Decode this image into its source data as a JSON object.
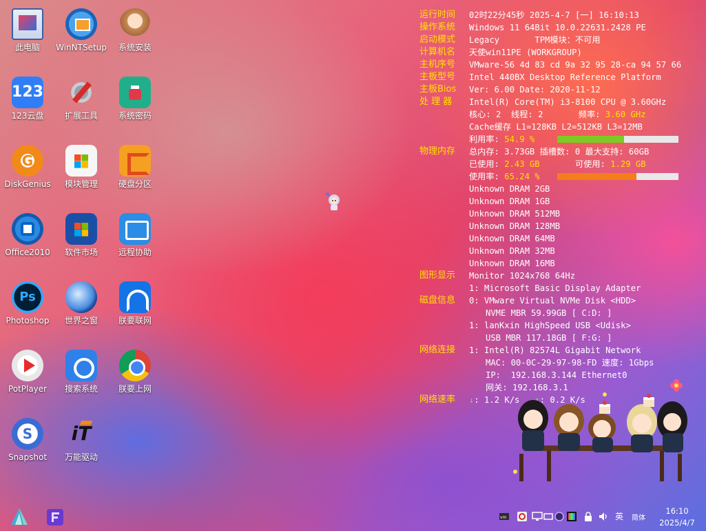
{
  "desktop": {
    "icons": [
      {
        "label": "此电脑",
        "icon": "computer-icon"
      },
      {
        "label": "WinNTSetup",
        "icon": "winntsetup-icon"
      },
      {
        "label": "系统安装",
        "icon": "system-install-icon"
      },
      {
        "label": "123云盘",
        "icon": "123-cloud-icon"
      },
      {
        "label": "扩展工具",
        "icon": "tools-icon"
      },
      {
        "label": "系统密码",
        "icon": "password-icon"
      },
      {
        "label": "DiskGenius",
        "icon": "diskgenius-icon"
      },
      {
        "label": "模块管理",
        "icon": "module-manager-icon"
      },
      {
        "label": "硬盘分区",
        "icon": "disk-partition-icon"
      },
      {
        "label": "Office2010",
        "icon": "office-icon"
      },
      {
        "label": "软件市场",
        "icon": "software-market-icon"
      },
      {
        "label": "远程协助",
        "icon": "remote-assist-icon"
      },
      {
        "label": "Photoshop",
        "icon": "photoshop-icon"
      },
      {
        "label": "世界之窗",
        "icon": "browser-globe-icon"
      },
      {
        "label": "朕要联网",
        "icon": "wifi-icon"
      },
      {
        "label": "PotPlayer",
        "icon": "potplayer-icon"
      },
      {
        "label": "搜索系统",
        "icon": "search-system-icon"
      },
      {
        "label": "朕要上网",
        "icon": "chrome-icon"
      },
      {
        "label": "Snapshot",
        "icon": "snapshot-icon"
      },
      {
        "label": "万能驱动",
        "icon": "driver-icon"
      }
    ]
  },
  "sysinfo": {
    "uptime_label": "运行时间",
    "uptime_value": "02时22分45秒 2025-4-7 [一] 16:10:13",
    "os_label": "操作系统",
    "os_value": "Windows 11 64Bit 10.0.22631.2428 PE",
    "boot_label": "启动模式",
    "boot_value": "Legacy       TPM模块：不可用",
    "hostname_label": "计算机名",
    "hostname_value": "天使win11PE (WORKGROUP)",
    "serial_label": "主机序号",
    "serial_value": "VMware-56 4d 83 cd 9a 32 95 28-ca 94 57 66",
    "board_label": "主板型号",
    "board_value": "Intel 440BX Desktop Reference Platform",
    "bios_label": "主板Bios",
    "bios_value": "Ver: 6.00 Date: 2020-11-12",
    "cpu_label": "处 理 器",
    "cpu_value": "Intel(R) Core(TM) i3-8100 CPU @ 3.60GHz",
    "cores_value": "核心: 2  线程: 2       频率: ",
    "freq_value": "3.60 GHz",
    "cache_value": "Cache缓存 L1=128KB  L2=512KB  L3=12MB",
    "cpu_usage_label": "利用率: ",
    "cpu_usage_value": "54.9 %",
    "cpu_usage_fraction": 0.549,
    "cpu_bar_color": "#7ccb22",
    "mem_label": "物理内存",
    "mem_total_value": "总内存: 3.73GB  插槽数: 0  最大支持: 60GB",
    "mem_used_label": "已使用: ",
    "mem_used_value": "2.43 GB",
    "mem_avail_label": "       可使用: ",
    "mem_avail_value": "1.29 GB",
    "mem_usage_label": "使用率: ",
    "mem_usage_value": "65.24 %",
    "mem_usage_fraction": 0.6524,
    "mem_bar_color": "#f47e1a",
    "dram": [
      "Unknown  DRAM 2GB",
      "Unknown  DRAM 1GB",
      "Unknown  DRAM 512MB",
      "Unknown  DRAM 128MB",
      "Unknown  DRAM 64MB",
      "Unknown  DRAM 32MB",
      "Unknown  DRAM 16MB"
    ],
    "display_label": "图形显示",
    "display_value": "Monitor 1024x768 64Hz",
    "display_adapter": "1: Microsoft Basic Display Adapter",
    "disk_label": "磁盘信息",
    "disk0": "0: VMware Virtual NVMe Disk <HDD>",
    "disk0_detail": "NVME MBR 59.99GB [ C:D: ]",
    "disk1": "1: lanKxin HighSpeed USB <Udisk>",
    "disk1_detail": "USB MBR 117.18GB [ F:G: ]",
    "net_label": "网络连接",
    "net_adapter": "1: Intel(R) 82574L Gigabit Network",
    "net_mac": "MAC: 00-0C-29-97-98-FD 速度: 1Gbps",
    "net_ip": "IP:  192.168.3.144 Ethernet0",
    "net_gateway": "网关: 192.168.3.1",
    "speed_label": "网络速率",
    "speed_down_arrow": "↓",
    "speed_down": ": 1.2 K/s",
    "speed_up_arrow": "↑",
    "speed_up": ": 0.2 K/s"
  },
  "taskbar": {
    "input_lang": "英",
    "input_mode": "简体",
    "time": "16:10",
    "date": "2025/4/7"
  }
}
